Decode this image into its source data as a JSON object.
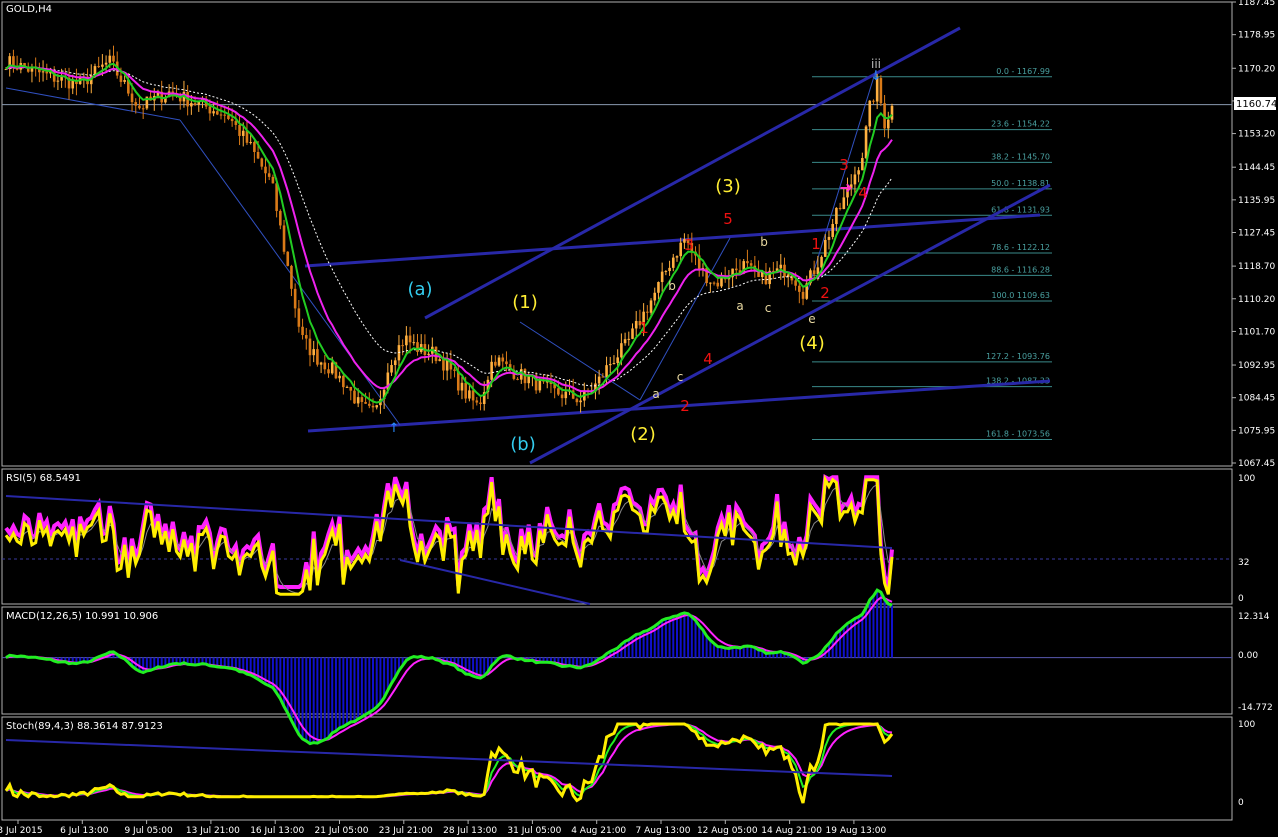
{
  "chart_data": {
    "type": "candlestick",
    "symbol": "GOLD,H4",
    "current_price": "1160.74",
    "price_ticks": [
      "1187.45",
      "1178.95",
      "1170.20",
      "1161.70",
      "1153.20",
      "1144.45",
      "1135.95",
      "1127.45",
      "1118.70",
      "1110.20",
      "1101.70",
      "1092.95",
      "1084.45",
      "1075.95",
      "1067.45"
    ],
    "price_tick_values": [
      1187.45,
      1178.95,
      1170.2,
      1161.7,
      1153.2,
      1144.45,
      1135.95,
      1127.45,
      1118.7,
      1110.2,
      1101.7,
      1092.95,
      1084.45,
      1075.95,
      1067.45
    ],
    "time_labels": [
      "3 Jul 2015",
      "6 Jul 13:00",
      "9 Jul 05:00",
      "13 Jul 21:00",
      "16 Jul 13:00",
      "21 Jul 05:00",
      "23 Jul 21:00",
      "28 Jul 13:00",
      "31 Jul 05:00",
      "4 Aug 21:00",
      "7 Aug 13:00",
      "12 Aug 05:00",
      "14 Aug 21:00",
      "19 Aug 13:00"
    ],
    "price_path": [
      [
        0,
        1172
      ],
      [
        6,
        1168
      ],
      [
        10,
        1166
      ],
      [
        14,
        1172
      ],
      [
        18,
        1160
      ],
      [
        22,
        1164
      ],
      [
        26,
        1161
      ],
      [
        30,
        1158
      ],
      [
        33,
        1150
      ],
      [
        36,
        1140
      ],
      [
        38,
        1120
      ],
      [
        40,
        1100
      ],
      [
        42,
        1095
      ],
      [
        44,
        1092
      ],
      [
        46,
        1088
      ],
      [
        48,
        1082
      ],
      [
        50,
        1080
      ],
      [
        52,
        1094
      ],
      [
        54,
        1100
      ],
      [
        56,
        1097
      ],
      [
        58,
        1096
      ],
      [
        60,
        1092
      ],
      [
        62,
        1086
      ],
      [
        64,
        1082
      ],
      [
        66,
        1095
      ],
      [
        68,
        1092
      ],
      [
        70,
        1090
      ],
      [
        72,
        1088
      ],
      [
        74,
        1086
      ],
      [
        76,
        1085
      ],
      [
        78,
        1084
      ],
      [
        80,
        1088
      ],
      [
        82,
        1094
      ],
      [
        84,
        1098
      ],
      [
        86,
        1105
      ],
      [
        88,
        1112
      ],
      [
        90,
        1120
      ],
      [
        92,
        1126
      ],
      [
        94,
        1118
      ],
      [
        96,
        1114
      ],
      [
        98,
        1117
      ],
      [
        100,
        1119
      ],
      [
        102,
        1115
      ],
      [
        104,
        1117
      ],
      [
        106,
        1118
      ],
      [
        108,
        1112
      ],
      [
        110,
        1120
      ],
      [
        112,
        1130
      ],
      [
        114,
        1138
      ],
      [
        116,
        1148
      ],
      [
        117,
        1160
      ],
      [
        118,
        1166
      ],
      [
        119,
        1156
      ],
      [
        120,
        1160
      ]
    ],
    "fibonacci": [
      {
        "label": "0.0 - 1167.99",
        "value": 1167.99
      },
      {
        "label": "23.6 - 1154.22",
        "value": 1154.22
      },
      {
        "label": "38.2 - 1145.70",
        "value": 1145.7
      },
      {
        "label": "50.0 - 1138.81",
        "value": 1138.81
      },
      {
        "label": "61.8 - 1131.93",
        "value": 1131.93
      },
      {
        "label": "78.6 - 1122.12",
        "value": 1122.12
      },
      {
        "label": "88.6 - 1116.28",
        "value": 1116.28
      },
      {
        "label": "100.0 1109.63",
        "value": 1109.63
      },
      {
        "label": "127.2 - 1093.76",
        "value": 1093.76
      },
      {
        "label": "138.2 - 1087.33",
        "value": 1087.33
      },
      {
        "label": "161.8 - 1073.56",
        "value": 1073.56
      }
    ],
    "wave_labels": [
      {
        "text": "(a)",
        "color": "#33ccee",
        "big": true
      },
      {
        "text": "(b)",
        "color": "#33ccee",
        "big": true
      },
      {
        "text": "(1)",
        "color": "#ffee33",
        "big": true
      },
      {
        "text": "(2)",
        "color": "#ffee33",
        "big": true
      },
      {
        "text": "(3)",
        "color": "#ffee33",
        "big": true
      },
      {
        "text": "(4)",
        "color": "#ffee33",
        "big": true
      },
      {
        "text": "1",
        "color": "#ee1111",
        "big": false
      },
      {
        "text": "2",
        "color": "#ee1111",
        "big": false
      },
      {
        "text": "3",
        "color": "#ee1111",
        "big": false
      },
      {
        "text": "4",
        "color": "#ee1111",
        "big": false
      },
      {
        "text": "5",
        "color": "#ee1111",
        "big": false
      },
      {
        "text": "1",
        "color": "#ee1111",
        "big": false
      },
      {
        "text": "2",
        "color": "#ee1111",
        "big": false
      },
      {
        "text": "3",
        "color": "#ee1111",
        "big": false
      },
      {
        "text": "4",
        "color": "#ee1111",
        "big": false
      },
      {
        "text": "a",
        "color": "#e8d8a0",
        "big": false
      },
      {
        "text": "b",
        "color": "#e8d8a0",
        "big": false
      },
      {
        "text": "c",
        "color": "#e8d8a0",
        "big": false
      },
      {
        "text": "a",
        "color": "#e8d8a0",
        "big": false
      },
      {
        "text": "b",
        "color": "#e8d8a0",
        "big": false
      },
      {
        "text": "c",
        "color": "#e8d8a0",
        "big": false
      },
      {
        "text": "e",
        "color": "#e8d8a0",
        "big": false
      },
      {
        "text": "iii",
        "color": "#bbbbbb",
        "big": false
      }
    ],
    "indicators": {
      "rsi": {
        "label": "RSI(5) 68.5491",
        "ticks": [
          "100",
          "32",
          "0"
        ]
      },
      "macd": {
        "label": "MACD(12,26,5) 10.991 10.906",
        "ticks": [
          "12.314",
          "0.00",
          "-14.772"
        ]
      },
      "stoch": {
        "label": "Stoch(89,4,3) 88.3614 87.9123",
        "ticks": [
          "100",
          "0"
        ]
      }
    },
    "colors": {
      "candle_up": "#ffb040",
      "candle_down": "#d97a18",
      "ma_fast": "#22cc22",
      "ma_slow": "#ee22ee",
      "channel": "#2828a8",
      "fib": "#3a8a8a",
      "rsi_main": "#ffee00",
      "macd_signal": "#22ee22",
      "macd_hist": "#1010cc"
    }
  }
}
